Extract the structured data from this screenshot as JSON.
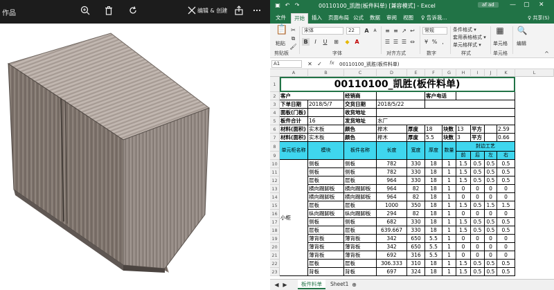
{
  "viewer": {
    "title": "作品",
    "zoom_icon": "zoom-in-icon",
    "delete_icon": "trash-icon",
    "rotate_icon": "rotate-icon",
    "edit_label": "编辑 & 创建",
    "share_icon": "share-icon",
    "more_icon": "more-icon",
    "image_desc": "wood cabinet render"
  },
  "excel": {
    "title": "00110100_凯胜(板件料单)  [兼容模式]  -  Excel",
    "user_badge": "af ad",
    "share_label": "♀ 共享(S)",
    "tabs": [
      "文件",
      "开始",
      "插入",
      "页面布局",
      "公式",
      "数据",
      "审阅",
      "视图",
      "♀ 告诉我..."
    ],
    "active_tab": "开始",
    "ribbon": {
      "clipboard_label": "剪贴板",
      "paste_label": "粘贴",
      "font_name": "宋体",
      "font_size": "22",
      "font_label": "字体",
      "align_label": "对齐方式",
      "number_format": "常规",
      "number_label": "数字",
      "cond_format": "条件格式 ▾",
      "table_format": "套用表格格式 ▾",
      "cell_style": "单元格样式 ▾",
      "styles_label": "样式",
      "cells_btn": "单元格",
      "cells_label": "单元格",
      "edit_btn": "编辑"
    },
    "formula_bar": {
      "name_box": "A1",
      "fx": "fx",
      "content": "00110100_凯胜(板件料单)"
    },
    "columns": [
      "A",
      "B",
      "C",
      "D",
      "E",
      "F",
      "G",
      "H",
      "I",
      "J",
      "K",
      "L"
    ],
    "rows": [
      "1",
      "2",
      "3",
      "4",
      "5",
      "6",
      "7",
      "8",
      "9",
      "10",
      "11",
      "12",
      "13",
      "14",
      "15",
      "16",
      "17",
      "18",
      "19",
      "20",
      "21",
      "22",
      "23"
    ],
    "title_cell": "00110100_凯胜(板件料单)",
    "info": {
      "customer": "客户",
      "dealer": "经销商",
      "phone": "客户电话",
      "order_date_label": "下单日期",
      "order_date": "2018/5/7",
      "delivery_date_label": "交货日期",
      "delivery_date": "2018/5/22",
      "door_label": "面板(门板)",
      "recv_label": "收货地址",
      "total_label": "板件合计",
      "total": "16",
      "send_label": "发货地址",
      "send": "水厂",
      "mat1_label": "材料(面积)",
      "mat1": "实木板",
      "color1_label": "颜色",
      "color1": "榉木",
      "thick1_label": "厚度",
      "thick1": "18",
      "count1_label": "块数",
      "count1": "13",
      "area1_label": "平方",
      "area1": "2.59",
      "mat2_label": "材料(面积)",
      "mat2": "实木板",
      "color2_label": "颜色",
      "color2": "榉木",
      "thick2_label": "厚度",
      "thick2": "5.5",
      "count2_label": "块数",
      "count2": "3",
      "area2_label": "平方",
      "area2": "0.66"
    },
    "table_headers": {
      "unit": "单元柜名称",
      "module": "模块",
      "part": "板件名称",
      "length": "长度",
      "width": "宽度",
      "thick": "厚度",
      "qty": "数量",
      "edge": "封边工艺",
      "front": "前",
      "back": "后",
      "left": "左",
      "right": "右"
    },
    "unit_name": "小柜",
    "parts": [
      {
        "module": "侧板",
        "part": "侧板",
        "length": "782",
        "width": "330",
        "thick": "18",
        "qty": "1",
        "f": "1.5",
        "b": "0.5",
        "l": "0.5",
        "r": "0.5"
      },
      {
        "module": "侧板",
        "part": "侧板",
        "length": "782",
        "width": "330",
        "thick": "18",
        "qty": "1",
        "f": "1.5",
        "b": "0.5",
        "l": "0.5",
        "r": "0.5"
      },
      {
        "module": "层板",
        "part": "层板",
        "length": "964",
        "width": "330",
        "thick": "18",
        "qty": "1",
        "f": "1.5",
        "b": "0.5",
        "l": "0.5",
        "r": "0.5"
      },
      {
        "module": "横向踢脚板",
        "part": "横向踢脚板",
        "length": "964",
        "width": "82",
        "thick": "18",
        "qty": "1",
        "f": "0",
        "b": "0",
        "l": "0",
        "r": "0"
      },
      {
        "module": "横向踢脚板",
        "part": "横向踢脚板",
        "length": "964",
        "width": "82",
        "thick": "18",
        "qty": "1",
        "f": "0",
        "b": "0",
        "l": "0",
        "r": "0"
      },
      {
        "module": "层板",
        "part": "层板",
        "length": "1000",
        "width": "350",
        "thick": "18",
        "qty": "1",
        "f": "1.5",
        "b": "0.5",
        "l": "1.5",
        "r": "1.5"
      },
      {
        "module": "纵向踢脚板",
        "part": "纵向踢脚板",
        "length": "294",
        "width": "82",
        "thick": "18",
        "qty": "1",
        "f": "0",
        "b": "0",
        "l": "0",
        "r": "0"
      },
      {
        "module": "侧板",
        "part": "侧板",
        "length": "682",
        "width": "330",
        "thick": "18",
        "qty": "1",
        "f": "1.5",
        "b": "0.5",
        "l": "0.5",
        "r": "0.5"
      },
      {
        "module": "层板",
        "part": "层板",
        "length": "639.667",
        "width": "330",
        "thick": "18",
        "qty": "1",
        "f": "1.5",
        "b": "0.5",
        "l": "0.5",
        "r": "0.5"
      },
      {
        "module": "薄背板",
        "part": "薄背板",
        "length": "342",
        "width": "650",
        "thick": "5.5",
        "qty": "1",
        "f": "0",
        "b": "0",
        "l": "0",
        "r": "0"
      },
      {
        "module": "薄背板",
        "part": "薄背板",
        "length": "342",
        "width": "650",
        "thick": "5.5",
        "qty": "1",
        "f": "0",
        "b": "0",
        "l": "0",
        "r": "0"
      },
      {
        "module": "薄背板",
        "part": "薄背板",
        "length": "692",
        "width": "316",
        "thick": "5.5",
        "qty": "1",
        "f": "0",
        "b": "0",
        "l": "0",
        "r": "0"
      },
      {
        "module": "层板",
        "part": "层板",
        "length": "306.333",
        "width": "310",
        "thick": "18",
        "qty": "1",
        "f": "1.5",
        "b": "0.5",
        "l": "0.5",
        "r": "0.5"
      },
      {
        "module": "背板",
        "part": "背板",
        "length": "697",
        "width": "324",
        "thick": "18",
        "qty": "1",
        "f": "1.5",
        "b": "0.5",
        "l": "0.5",
        "r": "0.5"
      }
    ],
    "sheet_tabs": [
      "板件料单",
      "Sheet1"
    ],
    "active_sheet": "板件料单",
    "colors": {
      "header_cyan": "#3fd6ee",
      "excel_green": "#217346"
    }
  }
}
